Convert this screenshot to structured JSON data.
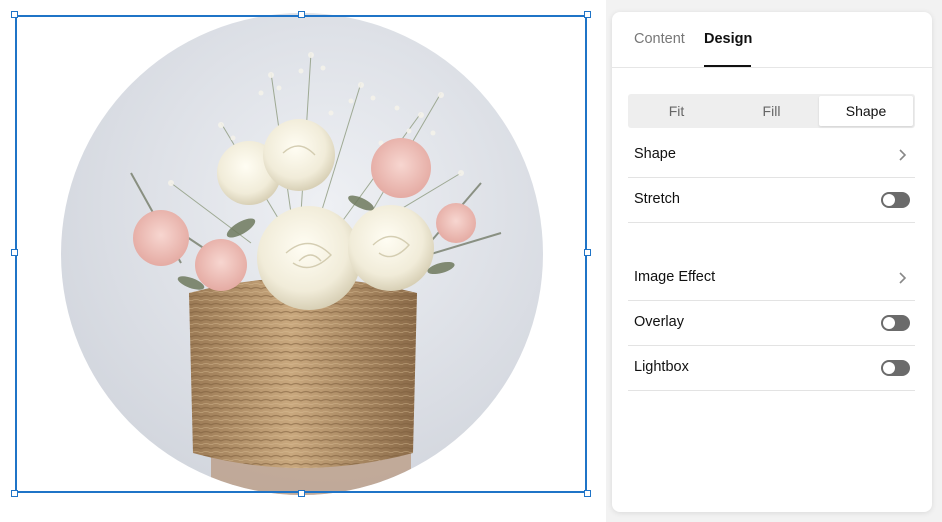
{
  "panel": {
    "tabs": [
      {
        "label": "Content",
        "selected": false
      },
      {
        "label": "Design",
        "selected": true
      }
    ],
    "mode_segments": [
      {
        "label": "Fit",
        "selected": false
      },
      {
        "label": "Fill",
        "selected": false
      },
      {
        "label": "Shape",
        "selected": true
      }
    ],
    "rows": {
      "shape": {
        "label": "Shape",
        "control": "chevron-right-icon"
      },
      "stretch": {
        "label": "Stretch",
        "control": "toggle",
        "on": false
      },
      "image_effect": {
        "label": "Image Effect",
        "control": "chevron-right-icon"
      },
      "overlay": {
        "label": "Overlay",
        "control": "toggle",
        "on": false
      },
      "lightbox": {
        "label": "Lightbox",
        "control": "toggle",
        "on": false
      }
    }
  },
  "canvas": {
    "image_block": {
      "shape": "circle",
      "selected": true
    }
  },
  "colors": {
    "selection": "#1f74c7",
    "toggle_off": "#6b6b6b",
    "active_text": "#111111",
    "inactive_text": "#777777"
  }
}
